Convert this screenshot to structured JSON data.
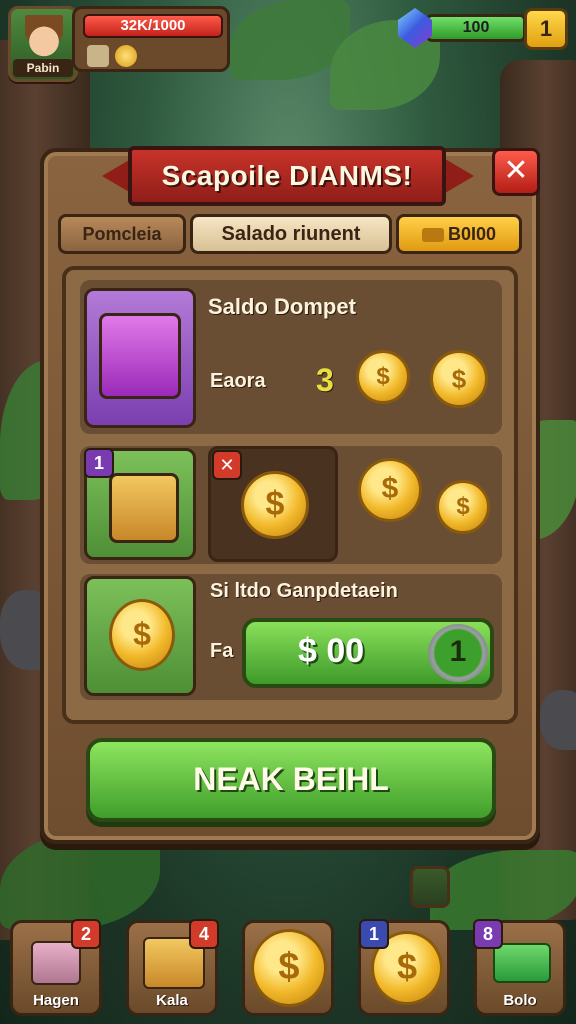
{
  "hud": {
    "player_name": "Pabin",
    "hp_text": "32K/1000",
    "resource_value": "100",
    "plus_label": "1"
  },
  "dialog": {
    "title": "Scapoile DIANMS!",
    "close_label": "✕",
    "tabs": [
      "Pomcleia",
      "Salado riunent",
      "B0I00"
    ],
    "section1_title": "Saldo Dompet",
    "section1_sub": "Eaora",
    "section1_count": "3",
    "badge_1": "1",
    "badge_x": "✕",
    "section3_title": "Si ltdo Ganpdetaein",
    "price_prefix": "Fa",
    "price_label": "$ 00",
    "price_circle": "1",
    "confirm_label": "NEAK BEIHL"
  },
  "bottom_bar": [
    {
      "label": "Hagen",
      "badge": "2",
      "badge_color": "#d23a2a"
    },
    {
      "label": "Kala",
      "badge": "4",
      "badge_color": "#d23a2a"
    },
    {
      "label": "",
      "badge": "",
      "badge_color": ""
    },
    {
      "label": "",
      "badge": "1",
      "badge_color": "#3a4ab0"
    },
    {
      "label": "Bolo",
      "badge": "8",
      "badge_color": "#7a3ab0"
    }
  ],
  "colors": {
    "panel": "#7a5634",
    "title_red": "#c8332a",
    "button_green": "#5cc23c",
    "coin_gold": "#f2b92a"
  }
}
